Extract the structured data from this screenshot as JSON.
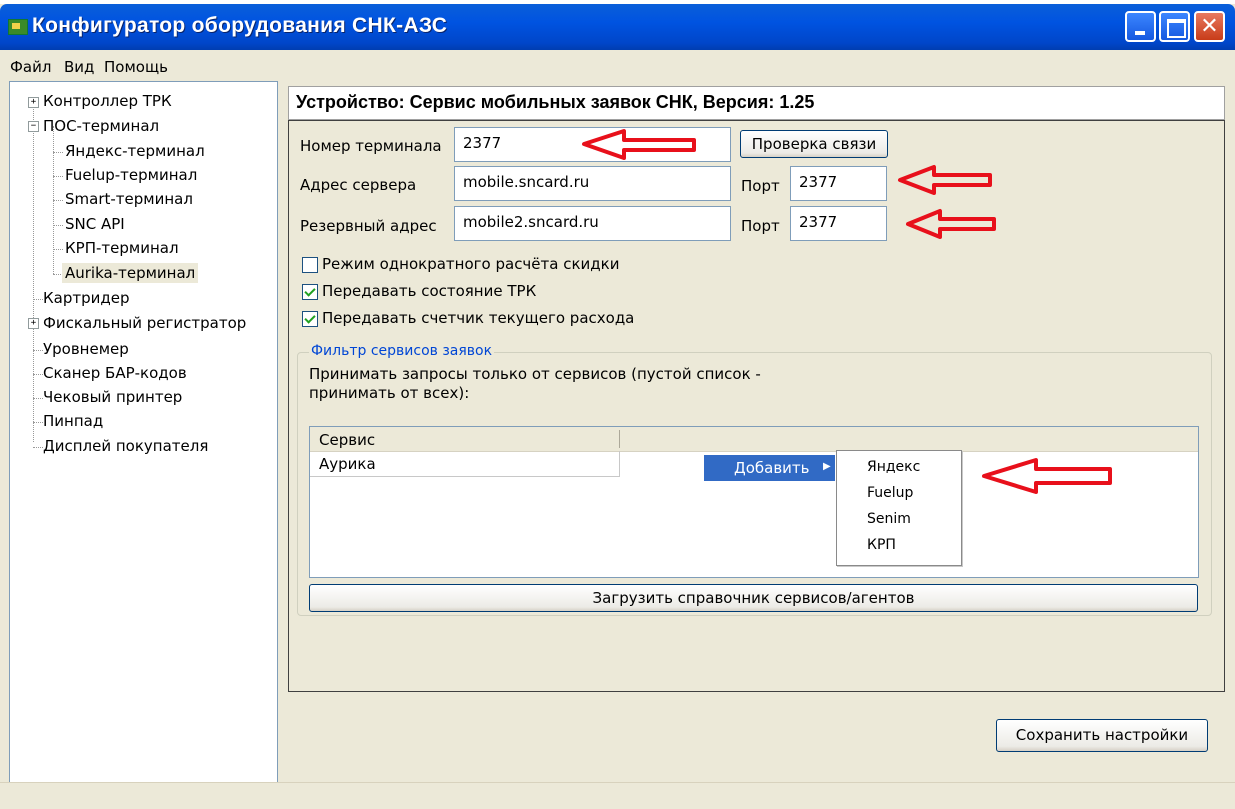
{
  "window": {
    "title": "Конфигуратор оборудования СНК-АЗС",
    "close_glyph": "✕"
  },
  "menu": [
    "Файл",
    "Вид",
    "Помощь"
  ],
  "tree": {
    "items": [
      {
        "label": "Контроллер ТРК",
        "expander": "+"
      },
      {
        "label": "ПОС-терминал",
        "expander": "−"
      },
      {
        "label": "Яндекс-терминал"
      },
      {
        "label": "Fuelup-терминал"
      },
      {
        "label": "Smart-терминал"
      },
      {
        "label": "SNC API"
      },
      {
        "label": "КРП-терминал"
      },
      {
        "label": "Aurika-терминал",
        "selected": true
      },
      {
        "label": "Картридер"
      },
      {
        "label": "Фискальный регистратор",
        "expander": "+"
      },
      {
        "label": "Уровнемер"
      },
      {
        "label": "Сканер БАР-кодов"
      },
      {
        "label": "Чековый принтер"
      },
      {
        "label": "Пинпад"
      },
      {
        "label": "Дисплей покупателя"
      }
    ]
  },
  "device": {
    "header": "Устройство: Сервис мобильных заявок СНК, Версия: 1.25"
  },
  "form": {
    "terminal_label": "Номер терминала",
    "terminal_value": "2377",
    "check_button": "Проверка связи",
    "server_label": "Адрес сервера",
    "server_value": "mobile.sncard.ru",
    "port_label": "Порт",
    "port_value": "2377",
    "reserve_label": "Резервный адрес",
    "reserve_value": "mobile2.sncard.ru",
    "reserve_port_label": "Порт",
    "reserve_port_value": "2377"
  },
  "checkboxes": [
    {
      "label": "Режим однократного расчёта скидки",
      "checked": false
    },
    {
      "label": "Передавать состояние ТРК",
      "checked": true
    },
    {
      "label": "Передавать счетчик текущего расхода",
      "checked": true
    }
  ],
  "filter": {
    "legend": "Фильтр сервисов заявок",
    "description_line1": "Принимать запросы только от сервисов (пустой список -",
    "description_line2": "принимать от всех):",
    "column": "Сервис",
    "rows": [
      "Аурика"
    ],
    "load_button": "Загрузить справочник сервисов/агентов"
  },
  "context_menu": {
    "item": "Добавить",
    "submenu_arrow": "▶",
    "submenu": [
      "Яндекс",
      "Fuelup",
      "Senim",
      "КРП"
    ]
  },
  "save_button": "Сохранить настройки",
  "annotation_color": "#e8101b"
}
